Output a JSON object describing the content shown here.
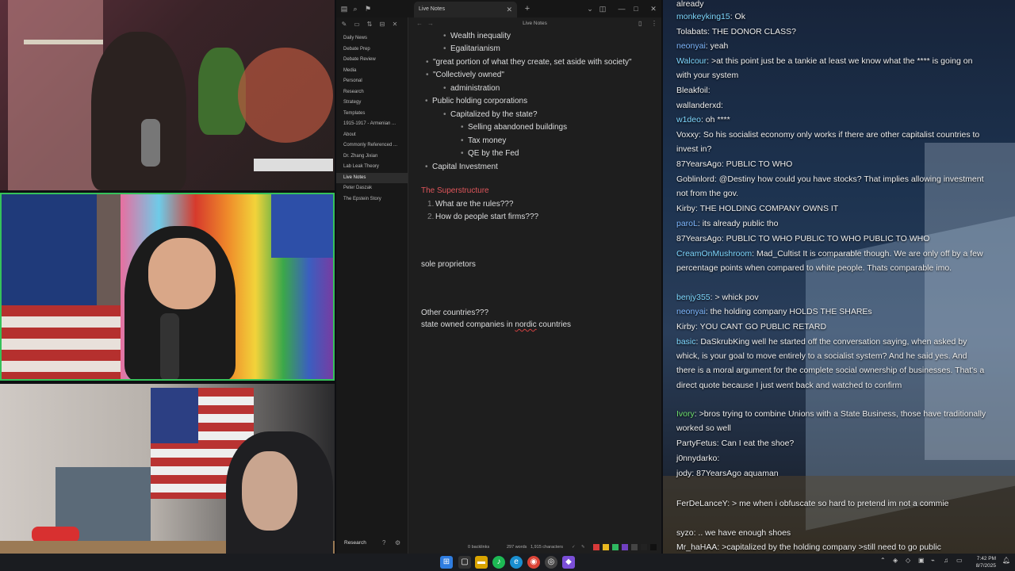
{
  "obsidian": {
    "tab_title": "Live Notes",
    "header_title": "Live Notes",
    "vault_name": "Research",
    "tree": [
      "Daily News",
      "Debate Prep",
      "Debate Review",
      "Media",
      "Personal",
      "Research",
      "Strategy",
      "Templates",
      "1915-1917 - Armenian ...",
      "About",
      "Commonly Referenced ...",
      "Dr. Zhang Jixian",
      "Lab Leak Theory",
      "Live Notes",
      "Peter Daszak",
      "The Epstein Story"
    ],
    "active_item": "Live Notes",
    "lines": {
      "l1": "Wealth inequality",
      "l2": "Egalitarianism",
      "l3": "\"great portion of what they create, set aside with society\"",
      "l4": "\"Collectively owned\"",
      "l5": "administration",
      "l6": "Public holding corporations",
      "l7": "Capitalized by the state?",
      "l8": "Selling abandoned buildings",
      "l9": "Tax money",
      "l10": "QE by the Fed",
      "l11": "Capital Investment",
      "h1": "The Superstructure",
      "n1": "What are the rules???",
      "n2": "How do people start firms???",
      "p1": "sole proprietors",
      "p2": "Other countries???",
      "p3a": "state owned companies in ",
      "p3b": "nordic",
      "p3c": " countries",
      "num1": "1.",
      "num2": "2."
    },
    "status": {
      "backlinks": "0 backlinks",
      "words": "297 words",
      "chars": "1,915 characters"
    }
  },
  "chat": [
    {
      "user": "",
      "text": "already",
      "color": "#f0f0f0"
    },
    {
      "user": "monkeyking15",
      "text": ": Ok",
      "color": "#7fd8ff"
    },
    {
      "user": "Tolabats",
      "text": ": THE DONOR CLASS?",
      "color": "#f0f0f0"
    },
    {
      "user": "neonyai",
      "text": ": yeah",
      "color": "#7fb8ff"
    },
    {
      "user": "Walcour",
      "text": ": >at this point just be a tankie at least we know what the **** is going on with your system",
      "color": "#7fd8ff"
    },
    {
      "user": "Bleakfoil",
      "text": ":",
      "color": "#f0f0f0"
    },
    {
      "user": "wallanderxd",
      "text": ":",
      "color": "#f0f0f0"
    },
    {
      "user": "w1deo",
      "text": ": oh ****",
      "color": "#7fd8ff"
    },
    {
      "user": "Voxxy",
      "text": ": So his socialist economy only works if there are other capitalist countries to invest in?",
      "color": "#f0f0f0"
    },
    {
      "user": "87YearsAgo",
      "text": ": PUBLIC TO WHO",
      "color": "#f0f0f0"
    },
    {
      "user": "Goblinlord",
      "text": ": @Destiny how could you have stocks? That implies allowing investment not from the gov.",
      "color": "#f0f0f0"
    },
    {
      "user": "Kirby",
      "text": ": THE HOLDING COMPANY OWNS IT",
      "color": "#f0f0f0"
    },
    {
      "user": "paroL",
      "text": ": its already public tho",
      "color": "#7fb8ff"
    },
    {
      "user": "87YearsAgo",
      "text": ": PUBLIC TO WHO PUBLIC TO WHO PUBLIC TO WHO",
      "color": "#f0f0f0"
    },
    {
      "user": "CreamOnMushroom",
      "text": ": Mad_Cultist It is comparable though. We are only off by a few percentage points when compared to white people. Thats comparable imo.",
      "color": "#7fd8ff"
    },
    {
      "user": "benjy355",
      "text": ": > whick pov",
      "color": "#7fd8ff"
    },
    {
      "user": "neonyai",
      "text": ": the holding company HOLDS THE SHAREs",
      "color": "#7fb8ff"
    },
    {
      "user": "Kirby",
      "text": ": YOU CANT GO PUBLIC RETARD",
      "color": "#f0f0f0"
    },
    {
      "user": "basic",
      "text": ": DaSkrubKing well he started off the conversation saying, when asked by whick, is your goal to move entirely to a socialist system? And he said yes. And there is a moral argument for the complete social ownership of businesses. That's a direct quote because I just went back and watched to confirm",
      "color": "#7fd8ff"
    },
    {
      "user": "Ivory",
      "text": ": >bros trying to combine Unions with a State Business, those have traditionally worked so well",
      "color": "#6ee06e"
    },
    {
      "user": "PartyFetus",
      "text": ": Can I eat the shoe?",
      "color": "#f0f0f0"
    },
    {
      "user": "j0nnydarko",
      "text": ":",
      "color": "#f0f0f0"
    },
    {
      "user": "jody",
      "text": ": 87YearsAgo aquaman",
      "color": "#f0f0f0"
    },
    {
      "user": "FerDeLanceY",
      "text": ": > me when i obfuscate so hard to pretend im not a commie",
      "color": "#f0f0f0"
    },
    {
      "user": "syzo",
      "text": ": .. we have enough shoes",
      "color": "#f0f0f0"
    },
    {
      "user": "Mr_haHAA",
      "text": ": >capitalized by the holding company >still need to go public",
      "color": "#f0f0f0"
    }
  ],
  "taskbar": {
    "time": "7:42 PM",
    "date": "8/7/2025"
  },
  "colors": {
    "accent_red": "#e0565b",
    "cam_border": "#35c25a",
    "editor_bg": "#1e1e1e"
  }
}
